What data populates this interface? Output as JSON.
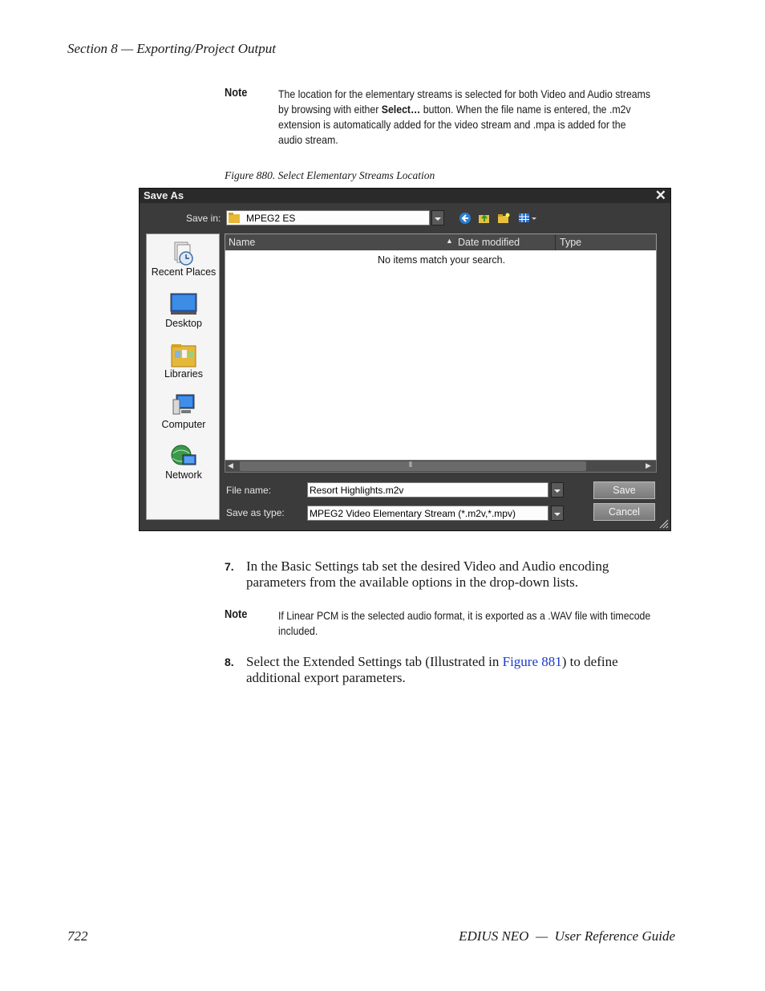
{
  "page": {
    "section_header": "Section 8 — Exporting/Project Output",
    "note1": {
      "label": "Note",
      "text_before": "The location for the elementary streams is selected for both Video and Audio streams by browsing with either ",
      "bold": "Select…",
      "text_after": " button. When the file name is entered, the .m2v extension is automatically added for the video stream and .mpa is added for the audio stream."
    },
    "figure_caption": "Figure 880.  Select Elementary Streams Location",
    "step7": {
      "number": "7.",
      "text": "In the Basic Settings tab set the desired Video and Audio encoding parameters from the available options in the drop-down lists."
    },
    "note2": {
      "label": "Note",
      "text": "If Linear PCM is the selected audio format, it is exported as a .WAV file with timecode included."
    },
    "step8": {
      "number": "8.",
      "text_before": "Select the Extended Settings tab (Illustrated in ",
      "link": "Figure 881",
      "text_after": ") to define additional export parameters."
    },
    "footer": {
      "page_number": "722",
      "title": "EDIUS NEO  —  User Reference Guide"
    }
  },
  "dialog": {
    "title": "Save As",
    "close_glyph": "✕",
    "save_in_label": "Save in:",
    "save_in_value": "MPEG2 ES",
    "places": [
      "Recent Places",
      "Desktop",
      "Libraries",
      "Computer",
      "Network"
    ],
    "columns": [
      "Name",
      "Date modified",
      "Type"
    ],
    "empty_message": "No items match your search.",
    "file_name_label": "File name:",
    "file_name_value": "Resort Highlights.m2v",
    "save_type_label": "Save as type:",
    "save_type_value": "MPEG2 Video Elementary Stream (*.m2v,*.mpv)",
    "save_button": "Save",
    "cancel_button": "Cancel",
    "toolbar_icons": [
      "back-icon",
      "up-folder-icon",
      "new-folder-icon",
      "view-menu-icon"
    ]
  }
}
